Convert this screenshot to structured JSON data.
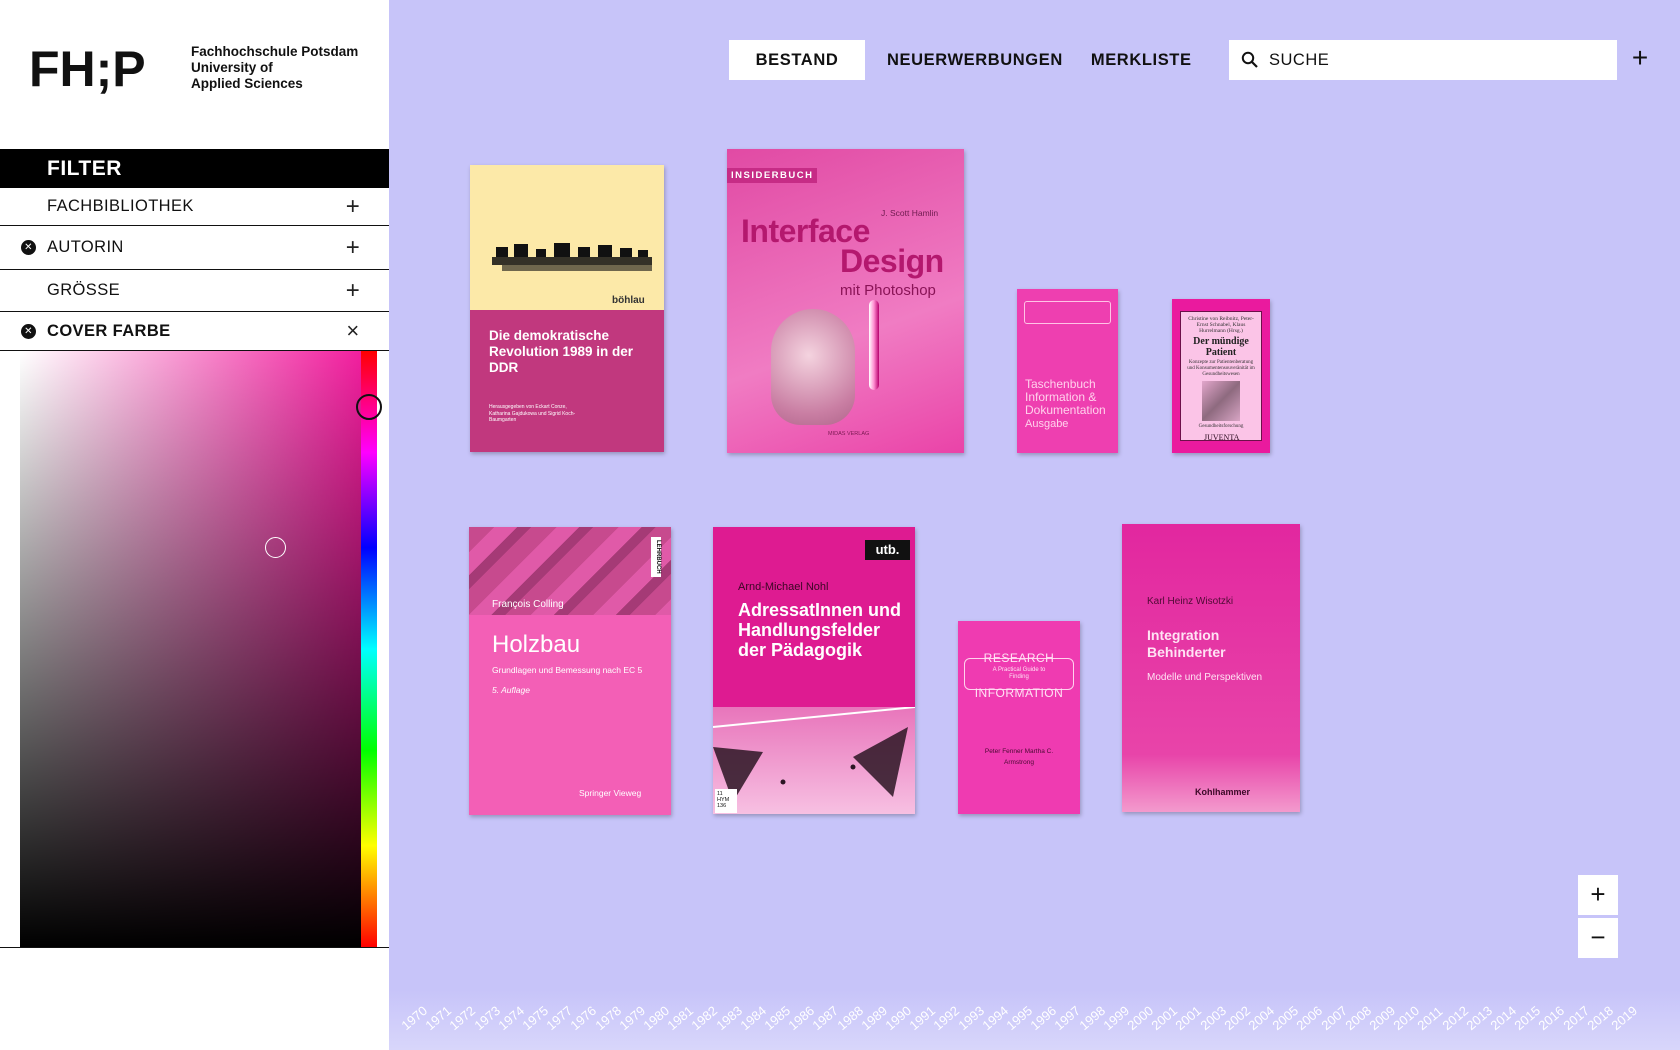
{
  "logo": {
    "mark": "FH;P",
    "lines": [
      "Fachhochschule Potsdam",
      "University of",
      "Applied Sciences"
    ]
  },
  "filter": {
    "title": "FILTER",
    "rows": [
      {
        "label": "FACHBIBLIOTHEK",
        "active": false,
        "action": "+"
      },
      {
        "label": "AUTORIN",
        "active": true,
        "action": "+"
      },
      {
        "label": "GRÖSSE",
        "active": false,
        "action": "+"
      },
      {
        "label": "COVER FARBE",
        "active": true,
        "action": "×"
      }
    ],
    "clear_glyph": "✕"
  },
  "color_picker": {
    "selected_hue_color": "#f21e9e"
  },
  "nav": {
    "items": [
      "BESTAND",
      "NEUERWERBUNGEN",
      "MERKLISTE"
    ],
    "active": "BESTAND",
    "search_placeholder": "SUCHE",
    "add_glyph": "+"
  },
  "books": [
    {
      "bg": "#c1387e",
      "top_bg": "#fce9a8",
      "title": "Die demokratische Revolution 1989 in der DDR",
      "publisher": "böhlau",
      "editors": "Herausgegeben von Eckart Conze, Katharina Gajdukowa und Sigrid Koch-Baumgarten"
    },
    {
      "bg": "#e64aa6",
      "series": "INSIDERBUCH",
      "author": "J. Scott Hamlin",
      "title_l1": "Interface",
      "title_l2": "Design",
      "subtitle": "mit Photoshop",
      "publisher": "MIDAS VERLAG"
    },
    {
      "bg": "#ee3fb0",
      "title": "Taschenbuch Information & Dokumentation",
      "edition": "Ausgabe"
    },
    {
      "bg": "#ea1a9e",
      "editors": "Christine von Reibnitz, Peter-Ernst Schnabel, Klaus Hurrelmann (Hrsg.)",
      "title": "Der mündige Patient",
      "subtitle": "Konzepte zur Patientenberatung und Konsumentensouveränität im Gesundheitswesen",
      "series": "Gesundheitsforschung",
      "publisher": "JUVENTA"
    },
    {
      "bg": "#f35fb6",
      "author": "François Colling",
      "title": "Holzbau",
      "subtitle": "Grundlagen und Bemessung nach EC 5",
      "edition": "5. Auflage",
      "publisher": "Springer Vieweg",
      "badge": "LEHRBUCH"
    },
    {
      "bg": "#de1b91",
      "publisher": "utb.",
      "author": "Arnd-Michael Nohl",
      "title": "AdressatInnen und Handlungsfelder der Pädagogik",
      "shelf": "11 HYM 136"
    },
    {
      "bg": "#ef3bb1",
      "title_l1": "RESEARCH",
      "title_mid": "A Practical Guide to Finding",
      "title_l2": "INFORMATION",
      "authors": "Peter Fenner Martha C. Armstrong"
    },
    {
      "bg": "#e2279f",
      "author": "Karl Heinz Wisotzki",
      "title": "Integration Behinderter",
      "subtitle": "Modelle und Perspektiven",
      "publisher": "Kohlhammer"
    }
  ],
  "zoom": {
    "in": "+",
    "out": "−"
  },
  "timeline": {
    "years": [
      "1970",
      "1971",
      "1972",
      "1973",
      "1974",
      "1975",
      "1977",
      "1976",
      "1978",
      "1979",
      "1980",
      "1981",
      "1982",
      "1983",
      "1984",
      "1985",
      "1986",
      "1987",
      "1988",
      "1989",
      "1990",
      "1991",
      "1992",
      "1993",
      "1994",
      "1995",
      "1996",
      "1997",
      "1998",
      "1999",
      "2000",
      "2001",
      "2001",
      "2003",
      "2002",
      "2004",
      "2005",
      "2006",
      "2007",
      "2008",
      "2009",
      "2010",
      "2011",
      "2012",
      "2013",
      "2014",
      "2015",
      "2016",
      "2017",
      "2018",
      "2019"
    ]
  }
}
